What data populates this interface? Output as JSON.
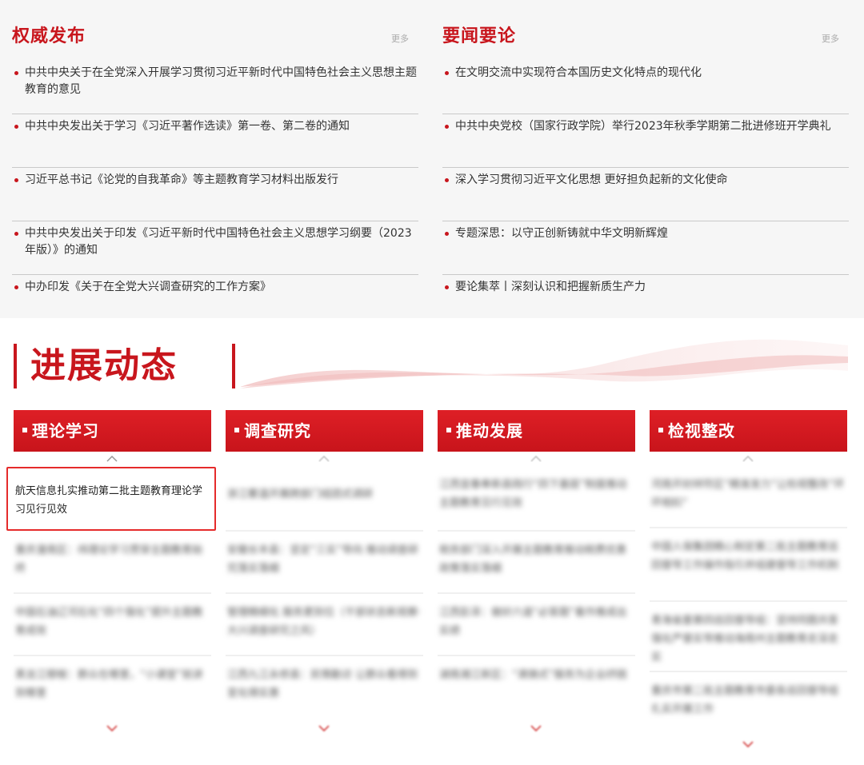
{
  "news_left": {
    "title": "权威发布",
    "more": "更多",
    "items": [
      "中共中央关于在全党深入开展学习贯彻习近平新时代中国特色社会主义思想主题教育的意见",
      "中共中央发出关于学习《习近平著作选读》第一卷、第二卷的通知",
      "习近平总书记《论党的自我革命》等主题教育学习材料出版发行",
      "中共中央发出关于印发《习近平新时代中国特色社会主义思想学习纲要（2023年版）》的通知",
      "中办印发《关于在全党大兴调查研究的工作方案》"
    ]
  },
  "news_right": {
    "title": "要闻要论",
    "more": "更多",
    "items": [
      "在文明交流中实现符合本国历史文化特点的现代化",
      "中共中央党校（国家行政学院）举行2023年秋季学期第二批进修班开学典礼",
      "深入学习贯彻习近平文化思想 更好担负起新的文化使命",
      "专题深思：以守正创新铸就中华文明新辉煌",
      "要论集萃丨深刻认识和把握新质生产力"
    ]
  },
  "section": {
    "title": "进展动态"
  },
  "columns": [
    {
      "label": "理论学习",
      "active_item": "航天信息扎实推动第二批主题教育理论学习见行见效",
      "items": [
        "重庆潼南区：纬理论学习贯穿主题教育始终",
        "中国石油辽河石化“四个强化”提升主题教育成效",
        "黑龙江穆棱：群众在哪里，“小课堂”就讲到哪里"
      ]
    },
    {
      "label": "调查研究",
      "items": [
        "浙江衢温开展跨部门组团式调研",
        "安徽长丰县：坚定“三实”导向 推动调查研究落实落细",
        "管理精细化 服务更到位（干部状态新观察·大兴调查研究之风）",
        "江西九江永修县：民情勤访 让群众看得到变化得实惠"
      ]
    },
    {
      "label": "推动发展",
      "items": [
        "江西宜春奉新县践行“四下基层”制度推动主题教育见行见效",
        "税务部门深入开展主题教育推动税费优惠政策落实落细",
        "江西彭泽：做好六道“必答题”着作推成出实绩",
        "湖南湘江新区：“滴铸式”服务为企业纾困"
      ]
    },
    {
      "label": "检视整改",
      "items": [
        "河南开封祥符区“精准发力”让检视整改“环环相扣”",
        "中国人保集团精心制定第二批主题教育巡回督导工作操作指引并组建督导工作机制",
        "青海省委第四巡回督导组：坚持同题共答 强化严督实导推动海南州主题教育走深走实",
        "重庆市第二批主题教育市委各巡回督导组扎实开展工作"
      ]
    }
  ]
}
